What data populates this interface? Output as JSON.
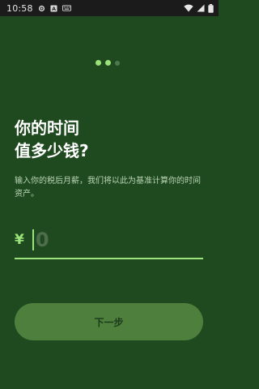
{
  "status_bar": {
    "time": "10:58",
    "left_icons": [
      "settings-icon",
      "a-notification-icon",
      "keyboard-icon"
    ],
    "right_icons": [
      "wifi-icon",
      "cell-signal-icon",
      "battery-icon"
    ]
  },
  "onboarding": {
    "page_indicator": {
      "total": 3,
      "active_index": 0
    },
    "title_line1": "你的时间",
    "title_line2": "值多少钱?",
    "subtitle": "输入你的税后月薪，我们将以此为基准计算你的时间资产。",
    "currency_symbol": "¥",
    "amount_placeholder": "0",
    "next_button_label": "下一步"
  },
  "colors": {
    "background": "#1f4a1f",
    "accent": "#9be27a",
    "button_bg": "#4e7f3c",
    "button_text": "#1a3a1a",
    "status_bar_bg": "#1b1b1b"
  }
}
